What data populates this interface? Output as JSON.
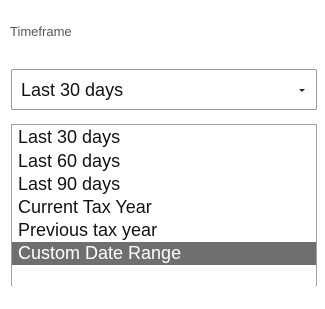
{
  "timeframe": {
    "label": "Timeframe",
    "selected_value": "Last 30 days",
    "arrow_icon": "dropdown-arrow-icon",
    "options": [
      "Last 30 days",
      "Last 60 days",
      "Last 90 days",
      "Current Tax Year",
      "Previous tax year",
      "Custom Date Range"
    ],
    "highlighted_option": "Custom Date Range"
  },
  "colors": {
    "highlight_background": "#6f6f6f",
    "highlight_text": "#ffffff",
    "border": "#9a9a9a"
  }
}
